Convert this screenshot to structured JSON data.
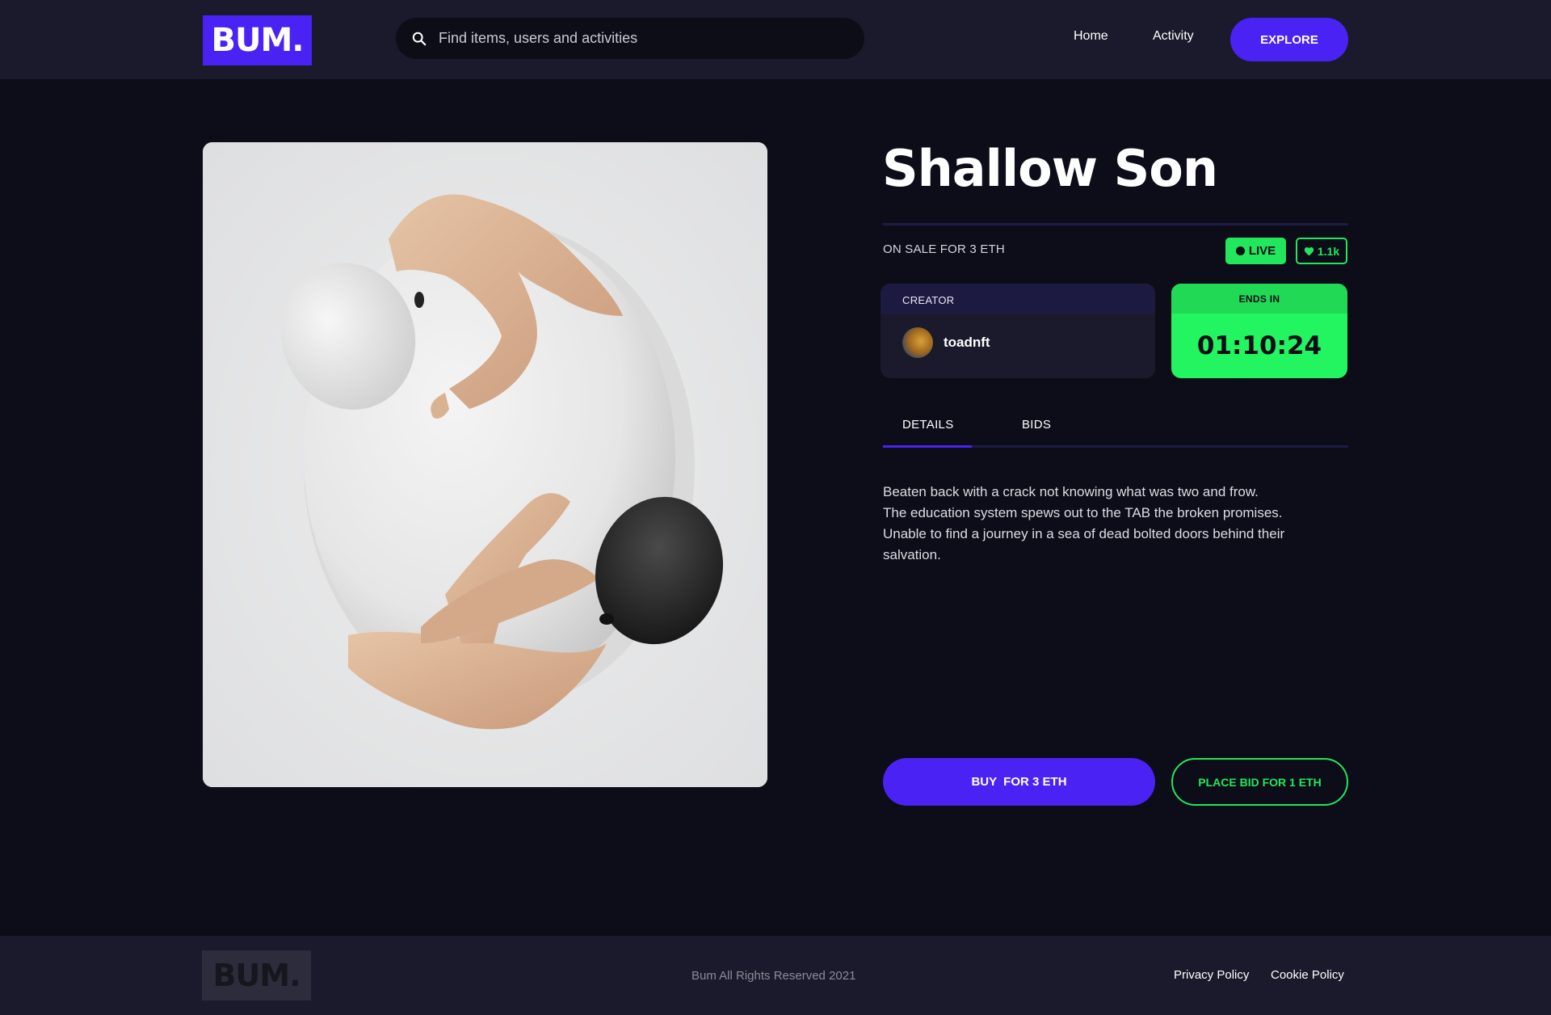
{
  "header": {
    "logo_text": "BUM.",
    "search_placeholder": "Find items, users and activities",
    "nav": {
      "home": "Home",
      "activity": "Activity",
      "explore": "EXPLORE"
    }
  },
  "item": {
    "title": "Shallow Son",
    "sale_text": "ON SALE FOR 3 ETH",
    "live_label": "LIVE",
    "likes": "1.1k",
    "creator": {
      "label": "CREATOR",
      "name": "toadnft"
    },
    "ends_in": {
      "label": "ENDS IN",
      "time": "01:10:24"
    },
    "tabs": [
      {
        "label": "DETAILS",
        "active": true
      },
      {
        "label": "BIDS",
        "active": false
      }
    ],
    "description_lines": [
      "Beaten back with a crack not knowing what was two and frow.",
      "The education system spews out to the TAB the broken promises.",
      "Unable to find a journey in a sea of dead bolted doors behind their",
      "salvation."
    ],
    "buy_label": "BUY  FOR 3 ETH",
    "bid_label": "PLACE BID FOR 1 ETH"
  },
  "footer": {
    "logo_text": "BUM.",
    "copyright": "Bum All Rights Reserved 2021",
    "links": {
      "privacy": "Privacy Policy",
      "cookie": "Cookie Policy"
    }
  },
  "colors": {
    "accent": "#4b22f4",
    "live_green": "#22e65c",
    "background": "#0c0d18",
    "surface": "#1a1a2c"
  },
  "icons": {
    "search": "search-icon",
    "heart": "heart-icon",
    "live_dot": "live-dot-icon"
  }
}
